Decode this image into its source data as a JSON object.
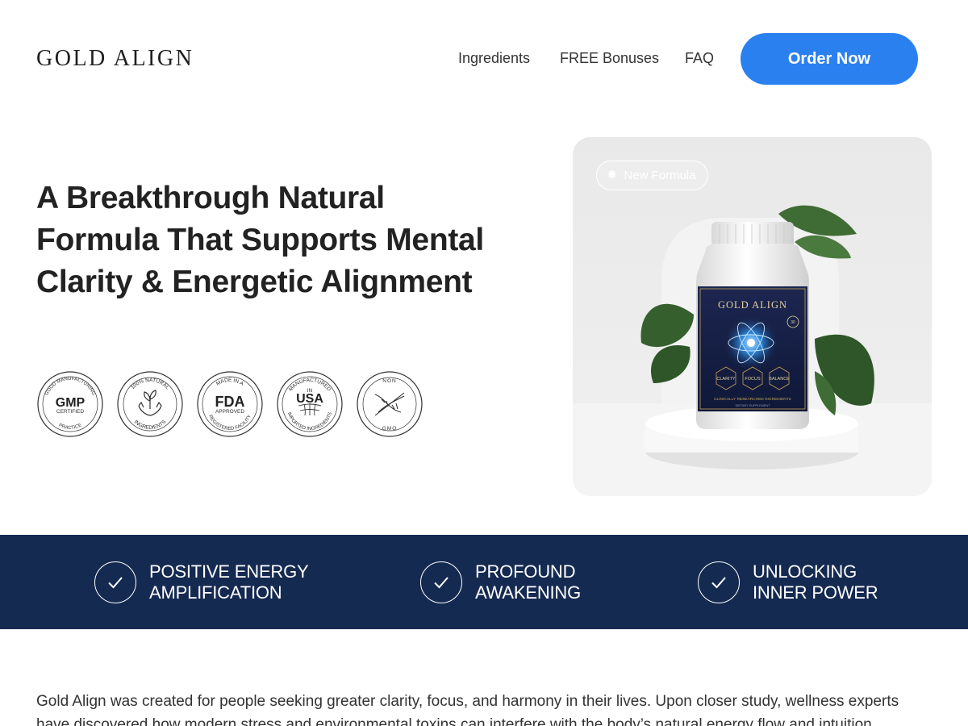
{
  "brand": {
    "logo_text": "GOLD ALIGN"
  },
  "nav": {
    "ingredients": "Ingredients",
    "bonuses": "FREE Bonuses",
    "faq": "FAQ",
    "order_button": "Order Now"
  },
  "hero": {
    "headline": "A Breakthrough Natural Formula That Supports Mental Clarity & Energetic Alignment",
    "badges": [
      {
        "name": "gmp",
        "top_text": "GOOD MANUFACTURING",
        "main": "GMP",
        "sub": "CERTIFIED",
        "bottom_text": "PRACTICE"
      },
      {
        "name": "natural",
        "top_text": "100% NATURAL",
        "bottom_text": "INGREDIENTS"
      },
      {
        "name": "fda",
        "top_text": "MADE IN A",
        "main": "FDA",
        "sub": "APPROVED",
        "bottom_text": "REGISTERED FACILITY"
      },
      {
        "name": "usa",
        "top_text": "MANUFACTURED",
        "in_text": "IN",
        "main": "USA",
        "bottom_text": "IMPORTED INGREDIENTS"
      },
      {
        "name": "gmo",
        "top_text": "NON",
        "bottom_text": "GMO"
      }
    ],
    "product": {
      "pill_label": "New Formula",
      "bottle_brand": "GOLD ALIGN",
      "bottle_tags": [
        "CLARITY",
        "FOCUS",
        "BALANCE"
      ],
      "bottle_count": "30",
      "bottle_line": "CLINICALLY RESEARCHED INGREDIENTS",
      "bottle_sub": "DIETARY SUPPLEMENT"
    }
  },
  "benefits": [
    {
      "line1": "POSITIVE ENERGY",
      "line2": "AMPLIFICATION"
    },
    {
      "line1": "PROFOUND",
      "line2": "AWAKENING"
    },
    {
      "line1": "UNLOCKING",
      "line2": "INNER POWER"
    }
  ],
  "intro": {
    "text": "Gold Align was created for people seeking greater clarity, focus, and harmony in their lives. Upon closer study, wellness experts have discovered how modern stress and environmental toxins can interfere with the body’s natural energy flow and intuition."
  },
  "colors": {
    "accent": "#2b80f0",
    "band": "#152a51",
    "text": "#222222"
  },
  "icons": {
    "pill": "sparkle-icon",
    "benefit": "check-circle-icon"
  }
}
